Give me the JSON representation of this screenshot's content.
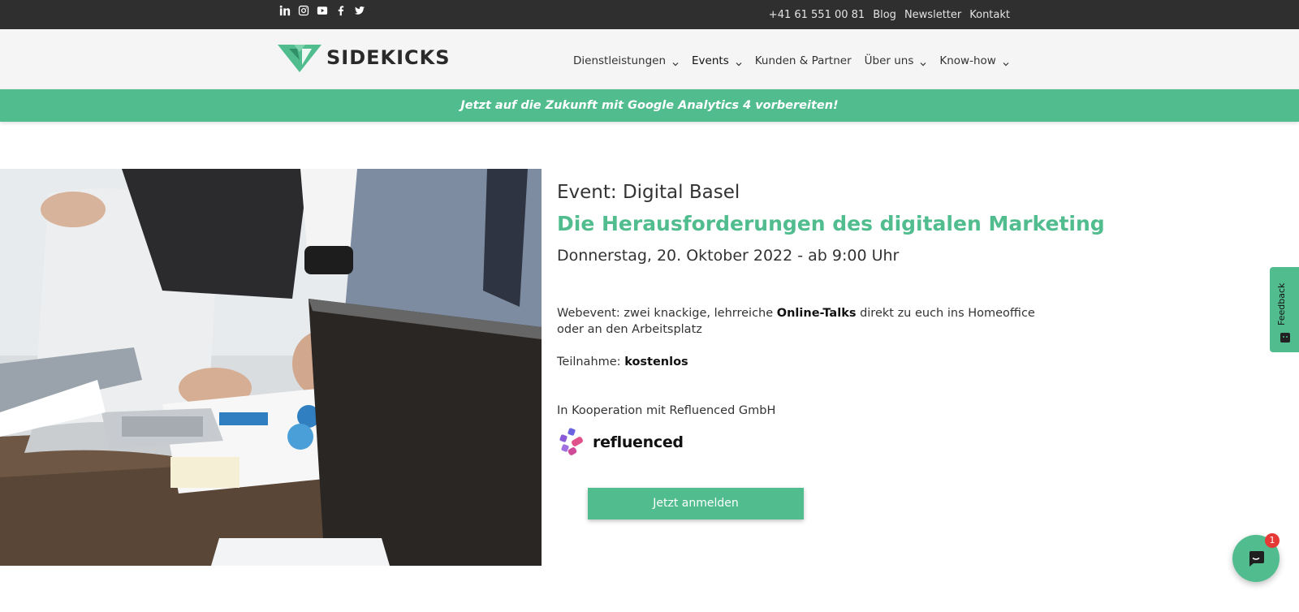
{
  "topbar": {
    "social_icons": [
      "linkedin-icon",
      "instagram-icon",
      "youtube-icon",
      "facebook-icon",
      "twitter-icon"
    ],
    "phone": "+41 61 551 00 81",
    "links": [
      "Blog",
      "Newsletter",
      "Kontakt"
    ]
  },
  "header": {
    "logo_text": "SIDEKICKS",
    "nav": [
      {
        "label": "Dienstleistungen",
        "has_dropdown": true
      },
      {
        "label": "Events",
        "has_dropdown": true
      },
      {
        "label": "Kunden & Partner",
        "has_dropdown": false
      },
      {
        "label": "Über uns",
        "has_dropdown": true
      },
      {
        "label": "Know-how",
        "has_dropdown": true
      }
    ]
  },
  "banner": {
    "text": "Jetzt auf die Zukunft mit Google Analytics 4 vorbereiten!"
  },
  "event": {
    "label": "Event: Digital Basel",
    "title": "Die Herausforderungen des digitalen Marketing",
    "date": "Donnerstag, 20. Oktober 2022 - ab 9:00 Uhr",
    "desc_before": "Webevent: zwei knackige, lehrreiche ",
    "desc_bold": "Online-Talks",
    "desc_after": " direkt zu euch ins Homeoffice oder an den Arbeitsplatz",
    "participation_label": "Teilnahme: ",
    "participation_value": "kostenlos",
    "cooperation": "In Kooperation mit Refluenced GmbH",
    "partner_name": "refluenced",
    "cta_label": "Jetzt anmelden"
  },
  "feedback": {
    "label": "Feedback"
  },
  "chat": {
    "badge_count": "1"
  },
  "colors": {
    "accent": "#51bd8f",
    "topbar": "#2f2f2f",
    "header": "#f5f5f5"
  }
}
